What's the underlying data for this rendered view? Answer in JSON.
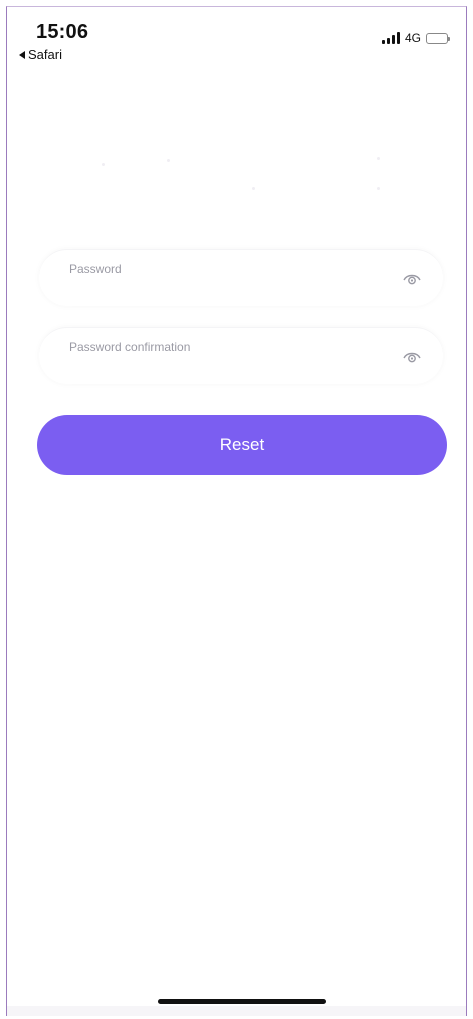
{
  "status_bar": {
    "time": "15:06",
    "back_label": "Safari",
    "network": "4G"
  },
  "form": {
    "password_placeholder": "Password",
    "password_confirmation_placeholder": "Password confirmation",
    "reset_label": "Reset"
  },
  "icons": {
    "back": "back-arrow-icon",
    "signal": "signal-icon",
    "battery": "battery-icon",
    "eye": "eye-icon"
  },
  "colors": {
    "accent": "#7b5ef1",
    "placeholder": "#9a9aa4",
    "frame_border": "#9b7bbd"
  }
}
